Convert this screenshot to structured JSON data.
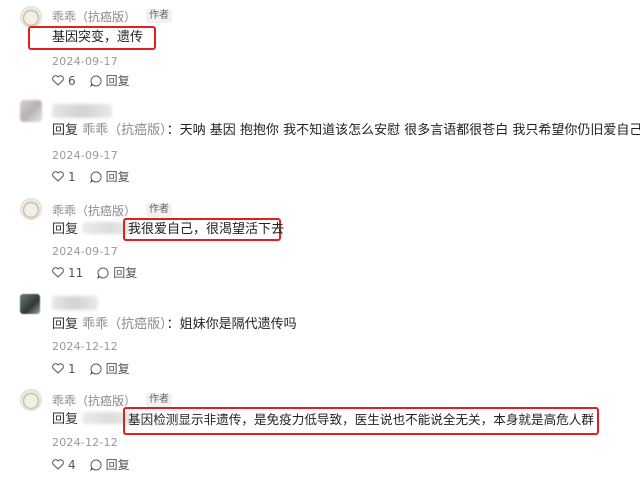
{
  "author_tag": "作者",
  "comments": [
    {
      "username": "乖乖（抗癌版）",
      "content": "基因突变，遗传",
      "date": "2024-09-17",
      "likes": "6",
      "reply_label": "回复"
    },
    {
      "reply_prefix": "回复",
      "mention": "乖乖（抗癌版）",
      "content": "：天呐 基因 抱抱你 我不知道该怎么安慰 很多言语都很苍白 我只希望你仍旧爱自己",
      "date": "2024-09-17",
      "likes": "1",
      "reply_label": "回复"
    },
    {
      "username": "乖乖（抗癌版）",
      "reply_prefix": "回复",
      "content": "我很爱自己，很渴望活下去",
      "date": "2024-09-17",
      "likes": "11",
      "reply_label": "回复"
    },
    {
      "reply_prefix": "回复",
      "mention": "乖乖（抗癌版）",
      "content": "：姐妹你是隔代遗传吗",
      "date": "2024-12-12",
      "likes": "1",
      "reply_label": "回复"
    },
    {
      "username": "乖乖（抗癌版）",
      "reply_prefix": "回复",
      "content": "基因检测显示非遗传，是免疫力低导致，医生说也不能说全无关，本身就是高危人群",
      "date": "2024-12-12",
      "likes": "4",
      "reply_label": "回复"
    }
  ]
}
